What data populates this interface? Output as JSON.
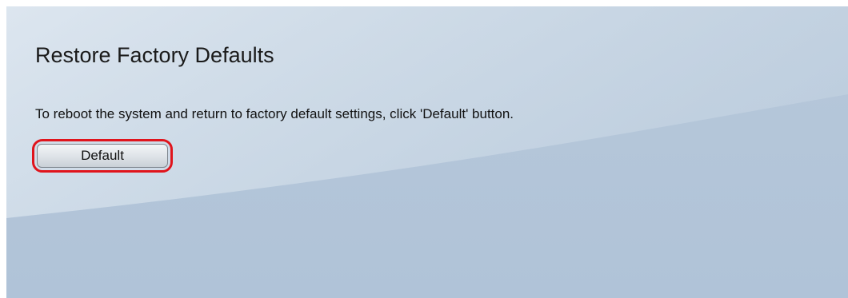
{
  "page": {
    "title": "Restore Factory Defaults",
    "instructions": "To reboot the system and return to factory default settings, click 'Default' button."
  },
  "actions": {
    "default_label": "Default"
  },
  "colors": {
    "background": "#b3c6da",
    "highlight_ring": "#e0141c",
    "text": "#111111"
  }
}
